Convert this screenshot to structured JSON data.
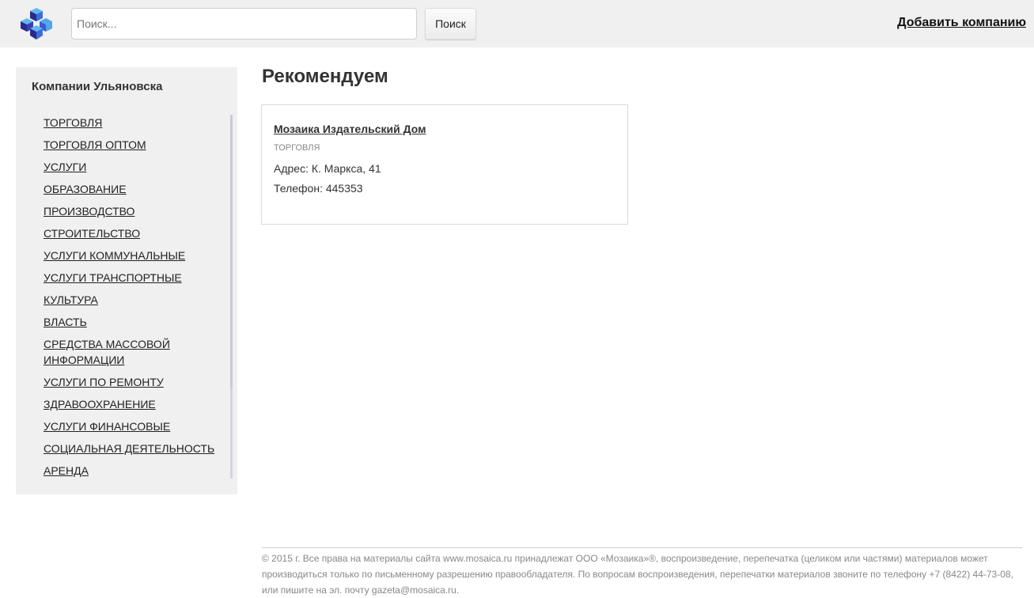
{
  "header": {
    "logo": "mosaica-cubes-logo",
    "search_placeholder": "Поиск...",
    "search_value": "",
    "search_button": "Поиск",
    "add_company": "Добавить компанию"
  },
  "sidebar": {
    "title": "Компании Ульяновска",
    "categories": [
      "ТОРГОВЛЯ",
      "ТОРГОВЛЯ ОПТОМ",
      "УСЛУГИ",
      "ОБРАЗОВАНИЕ",
      "ПРОИЗВОДСТВО",
      "СТРОИТЕЛЬСТВО",
      "УСЛУГИ КОММУНАЛЬНЫЕ",
      "УСЛУГИ ТРАНСПОРТНЫЕ",
      "КУЛЬТУРА",
      "ВЛАСТЬ",
      "СРЕДСТВА МАССОВОЙ ИНФОРМАЦИИ",
      "УСЛУГИ ПО РЕМОНТУ",
      "ЗДРАВООХРАНЕНИЕ",
      "УСЛУГИ ФИНАНСОВЫЕ",
      "СОЦИАЛЬНАЯ ДЕЯТЕЛЬНОСТЬ",
      "АРЕНДА"
    ]
  },
  "main": {
    "heading": "Рекомендуем",
    "card": {
      "title": "Мозаика Издательский Дом",
      "category": "ТОРГОВЛЯ",
      "address": "Адрес: К. Маркса, 41",
      "phone": "Телефон: 445353"
    }
  },
  "footer": {
    "text": "© 2015 г. Все права на материалы сайта www.mosaica.ru принадлежат ООО «Мозаика»®, воспроизведение, перепечатка (целиком или частями) материалов может производиться только по письменному разрешению правообладателя. По вопросам воспроизведения, перепечатки материалов звоните по телефону +7 (8422) 44-73-08, или пишите на эл. почту gazeta@mosaica.ru."
  },
  "colors": {
    "header_bg": "#f0f0f0",
    "sidebar_bg": "#f0f0f0",
    "logo_dark": "#2a2a8c",
    "logo_mid": "#3c5ad0",
    "logo_light": "#4fa6ea"
  }
}
